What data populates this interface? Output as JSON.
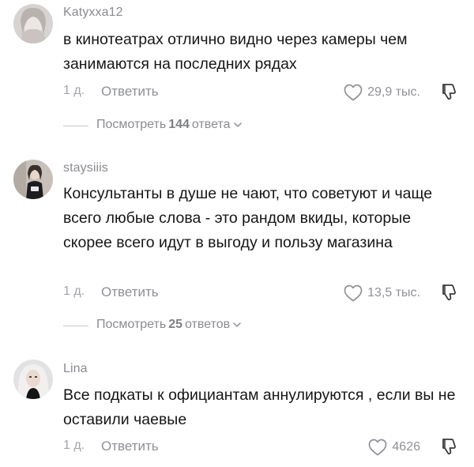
{
  "comments": [
    {
      "username": "Katyxxa12",
      "text": "в кинотеатрах отлично видно через камеры чем занимаются на последних рядах",
      "time": "1 д.",
      "reply_label": "Ответить",
      "likes": "29,9 тыс.",
      "view_replies": {
        "prefix": "Посмотреть",
        "count": "144",
        "suffix": "ответа"
      }
    },
    {
      "username": "staysiiis",
      "text": "Консультанты в душе не чают, что советуют и чаще всего любые слова - это рандом вкиды, которые скорее всего идут в выгоду и пользу магазина",
      "time": "1 д.",
      "reply_label": "Ответить",
      "likes": "13,5 тыс.",
      "view_replies": {
        "prefix": "Посмотреть",
        "count": "25",
        "suffix": "ответов"
      }
    },
    {
      "username": "Lina",
      "text": "Все подкаты к официантам аннулируются , если вы не оставили чаевые",
      "time": "1 д.",
      "reply_label": "Ответить",
      "likes": "4626"
    }
  ],
  "colors": {
    "username": "#8a8b91",
    "text": "#161616",
    "meta": "#a3a4a9",
    "icon": "#8f9096"
  },
  "icons": {
    "like": "heart-outline-icon",
    "dislike": "thumbs-down-outline-icon",
    "expand": "chevron-down-icon"
  }
}
